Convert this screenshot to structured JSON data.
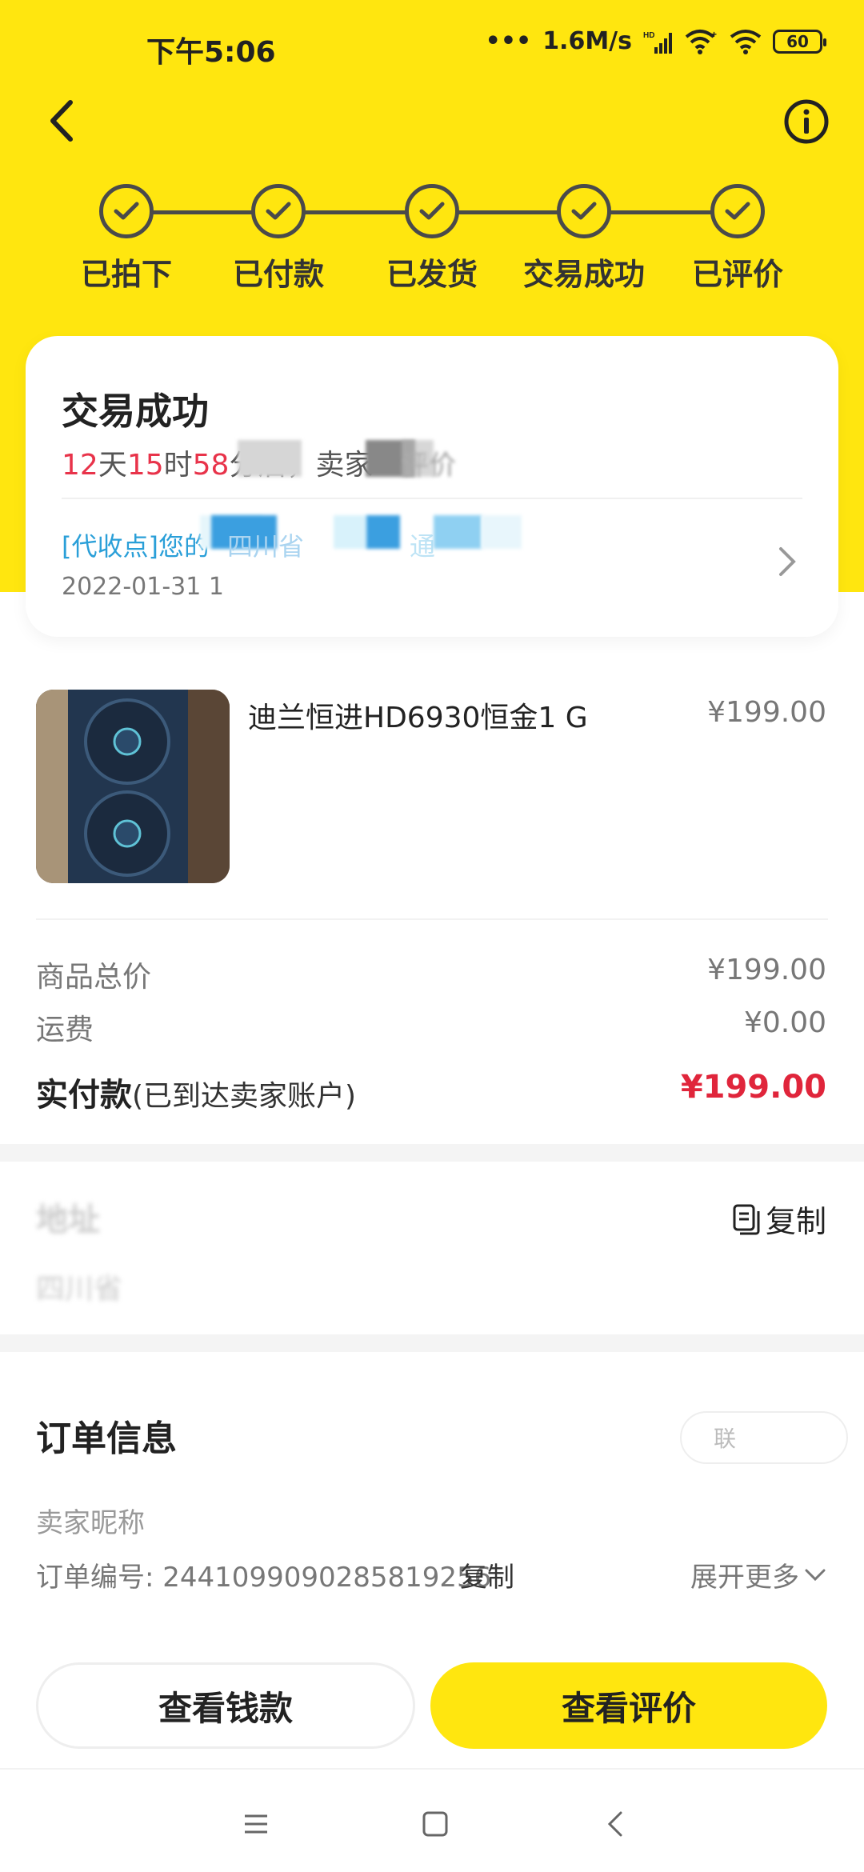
{
  "status_bar": {
    "time": "下午5:06",
    "network_speed": "1.6M/s",
    "network_type": "HD",
    "battery": "60"
  },
  "colors": {
    "accent": "#FFE60F",
    "price_red": "#E0253B",
    "link_blue": "#2a9fd8"
  },
  "progress": {
    "steps": [
      {
        "label": "已拍下",
        "done": true
      },
      {
        "label": "已付款",
        "done": true
      },
      {
        "label": "已发货",
        "done": true
      },
      {
        "label": "交易成功",
        "done": true
      },
      {
        "label": "已评价",
        "done": true
      }
    ]
  },
  "status_card": {
    "title": "交易成功",
    "countdown": {
      "days": "12",
      "days_unit": "天",
      "hours": "15",
      "hours_unit": "时",
      "minutes": "58",
      "suffix": "分后，卖家",
      "tail": "评价"
    },
    "logistics_text": "[代收点]您的",
    "logistics_mid": "四川省",
    "logistics_end": "通",
    "date": "2022-01-31 1"
  },
  "product": {
    "title": "迪兰恒进HD6930恒金1 G",
    "price": "¥199.00"
  },
  "prices": {
    "subtotal_label": "商品总价",
    "subtotal_value": "¥199.00",
    "shipping_label": "运费",
    "shipping_value": "¥0.00",
    "paid_label": "实付款",
    "paid_note": "(已到达卖家账户)",
    "paid_value": "¥199.00"
  },
  "address": {
    "title": "地址",
    "line": "四川省",
    "copy_label": "复制"
  },
  "order_info": {
    "title": "订单信息",
    "pill_text": "联",
    "seller_label": "卖家昵称",
    "order_no_label": "订单编号:",
    "order_no_value": "2441099090285819256",
    "copy_label": "复制",
    "expand_label": "展开更多"
  },
  "buttons": {
    "view_funds": "查看钱款",
    "view_review": "查看评价"
  }
}
